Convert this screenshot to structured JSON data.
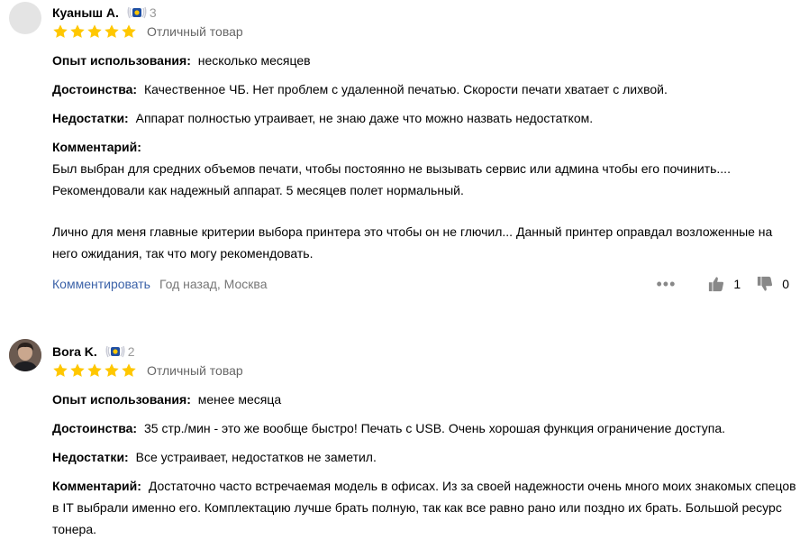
{
  "reviews": [
    {
      "author": "Куаныш А.",
      "badge_level": "3",
      "rating": 5,
      "rating_title": "Отличный товар",
      "experience_label": "Опыт использования:",
      "experience": "несколько месяцев",
      "pros_label": "Достоинства:",
      "pros": "Качественное ЧБ. Нет проблем с удаленной печатью. Скорости печати хватает с лихвой.",
      "cons_label": "Недостатки:",
      "cons": "Аппарат полностью утраивает, не знаю даже что можно назвать недостатком.",
      "comment_label": "Комментарий:",
      "comment_p1_line1": "Был выбран для средних объемов печати, чтобы постоянно не вызывать сервис или админа чтобы его починить....",
      "comment_p1_line2": "Рекомендовали как надежный аппарат. 5 месяцев полет нормальный.",
      "comment_p2_line1": "Лично для меня главные критерии выбора принтера это чтобы он не глючил... Данный принтер оправдал возложенные на",
      "comment_p2_line2": "него ожидания, так что могу рекомендовать.",
      "comment_action": "Комментировать",
      "meta": "Год назад, Москва",
      "likes": "1",
      "dislikes": "0"
    },
    {
      "author": "Bora K.",
      "badge_level": "2",
      "rating": 5,
      "rating_title": "Отличный товар",
      "experience_label": "Опыт использования:",
      "experience": "менее месяца",
      "pros_label": "Достоинства:",
      "pros": "35 стр./мин - это же вообще быстро! Печать с USB. Очень хорошая функция ограничение доступа.",
      "cons_label": "Недостатки:",
      "cons": "Все устраивает, недостатков не заметил.",
      "comment_label": "Комментарий:",
      "comment_line1": "Достаточно часто встречаемая модель в офисах. Из за своей надежности очень много моих знакомых спецов",
      "comment_line2": "в IT выбрали именно его. Комплектацию лучше брать полную, так как все равно рано или поздно их брать. Большой ресурс",
      "comment_line3": "тонера."
    }
  ],
  "colors": {
    "star": "#ffc700",
    "link": "#3b62a8",
    "muted": "#777777",
    "badge_blue": "#1f4fa3"
  },
  "icons": [
    "avatar-placeholder",
    "achievement-badge-icon",
    "star-icon",
    "more-dots-icon",
    "thumbs-up-icon",
    "thumbs-down-icon"
  ]
}
